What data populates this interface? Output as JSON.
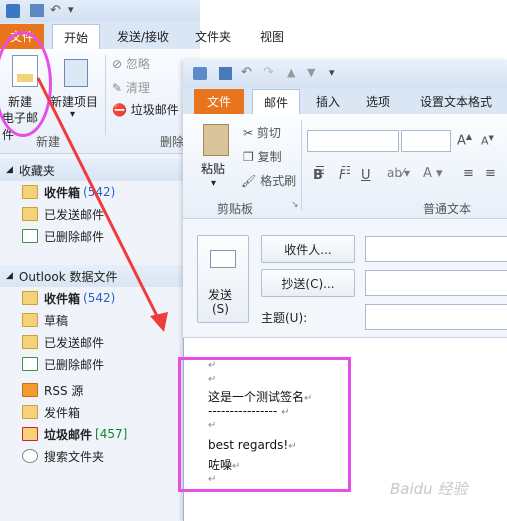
{
  "outlook": {
    "tabs": {
      "file": "文件",
      "home": "开始",
      "send_receive": "发送/接收",
      "folder": "文件夹",
      "view": "视图"
    },
    "ribbon": {
      "new_email_line1": "新建",
      "new_email_line2": "电子邮件",
      "new_items_line1": "新建项目",
      "ignore": "忽略",
      "clean": "清理",
      "junk": "垃圾邮件",
      "delete": "删除",
      "group_new": "新建"
    },
    "nav": {
      "favorites": "收藏夹",
      "fav_items": [
        {
          "label": "收件箱",
          "count": "(542)"
        },
        {
          "label": "已发送邮件",
          "count": ""
        },
        {
          "label": "已删除邮件",
          "count": ""
        }
      ],
      "datafile": "Outlook 数据文件",
      "data_items": [
        {
          "label": "收件箱",
          "count": "(542)"
        },
        {
          "label": "草稿",
          "count": ""
        },
        {
          "label": "已发送邮件",
          "count": ""
        },
        {
          "label": "已删除邮件",
          "count": ""
        },
        {
          "label": "RSS 源",
          "count": ""
        },
        {
          "label": "发件箱",
          "count": ""
        },
        {
          "label": "垃圾邮件",
          "count": "[457]"
        },
        {
          "label": "搜索文件夹",
          "count": ""
        }
      ]
    }
  },
  "compose": {
    "tabs": {
      "file": "文件",
      "mail": "邮件",
      "insert": "插入",
      "options": "选项",
      "format": "设置文本格式"
    },
    "clipboard": {
      "paste": "粘贴",
      "cut": "剪切",
      "copy": "复制",
      "format_painter": "格式刷",
      "group": "剪贴板"
    },
    "basic_text": {
      "group": "普通文本",
      "bold": "B",
      "italic": "I",
      "underline": "U"
    },
    "send_button": {
      "line1": "发送",
      "line2": "(S)"
    },
    "to_button": "收件人...",
    "cc_button": "抄送(C)...",
    "subject_label": "主题(U):",
    "signature_lines": [
      "这是一个测试签名",
      "----------------",
      "best regards!",
      "咗噪"
    ]
  },
  "watermark": "Baidu 经验"
}
